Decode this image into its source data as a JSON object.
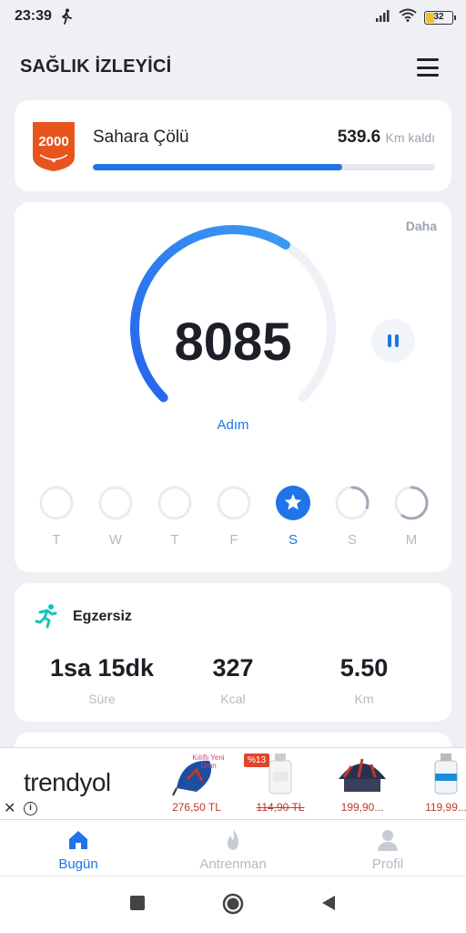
{
  "status_bar": {
    "time": "23:39",
    "battery": "32",
    "icons": [
      "walking-icon",
      "signal-icon",
      "wifi-icon",
      "battery-icon"
    ]
  },
  "header": {
    "title": "SAĞLIK İZLEYİCİ",
    "menu_icon": "hamburger-menu-icon"
  },
  "challenge": {
    "badge_number": "2000",
    "name": "Sahara Çölü",
    "remaining_value": "539.6",
    "remaining_unit": "Km kaldı",
    "progress_fraction": 0.73,
    "accent_color": "#1e74e8",
    "badge_color": "#e8541e"
  },
  "steps": {
    "more_label": "Daha",
    "value": "8085",
    "label": "Adım",
    "gauge_fraction": 0.62,
    "days": [
      {
        "label": "T",
        "fraction": 0,
        "active": false
      },
      {
        "label": "W",
        "fraction": 0,
        "active": false
      },
      {
        "label": "T",
        "fraction": 0,
        "active": false
      },
      {
        "label": "F",
        "fraction": 0,
        "active": false
      },
      {
        "label": "S",
        "fraction": 1,
        "active": true
      },
      {
        "label": "S",
        "fraction": 0.3,
        "active": false
      },
      {
        "label": "M",
        "fraction": 0.6,
        "active": false
      }
    ]
  },
  "exercise": {
    "title": "Egzersiz",
    "stats": [
      {
        "value": "1sa 15dk",
        "label": "Süre"
      },
      {
        "value": "327",
        "label": "Kcal"
      },
      {
        "value": "5.50",
        "label": "Km"
      }
    ]
  },
  "ad": {
    "brand": "trendyol",
    "products": [
      {
        "price": "276,50 TL",
        "tag": "Kılıflı Yeni Ürün",
        "discount": "",
        "strike": false
      },
      {
        "price": "114,90 TL",
        "tag": "",
        "discount": "%13",
        "strike": true
      },
      {
        "price": "199,90...",
        "tag": "",
        "discount": "",
        "strike": false
      },
      {
        "price": "119,99...",
        "tag": "",
        "discount": "",
        "strike": false
      }
    ]
  },
  "bottom_nav": [
    {
      "label": "Bugün",
      "icon": "home-icon",
      "active": true
    },
    {
      "label": "Antrenman",
      "icon": "flame-icon",
      "active": false
    },
    {
      "label": "Profil",
      "icon": "profile-icon",
      "active": false
    }
  ]
}
